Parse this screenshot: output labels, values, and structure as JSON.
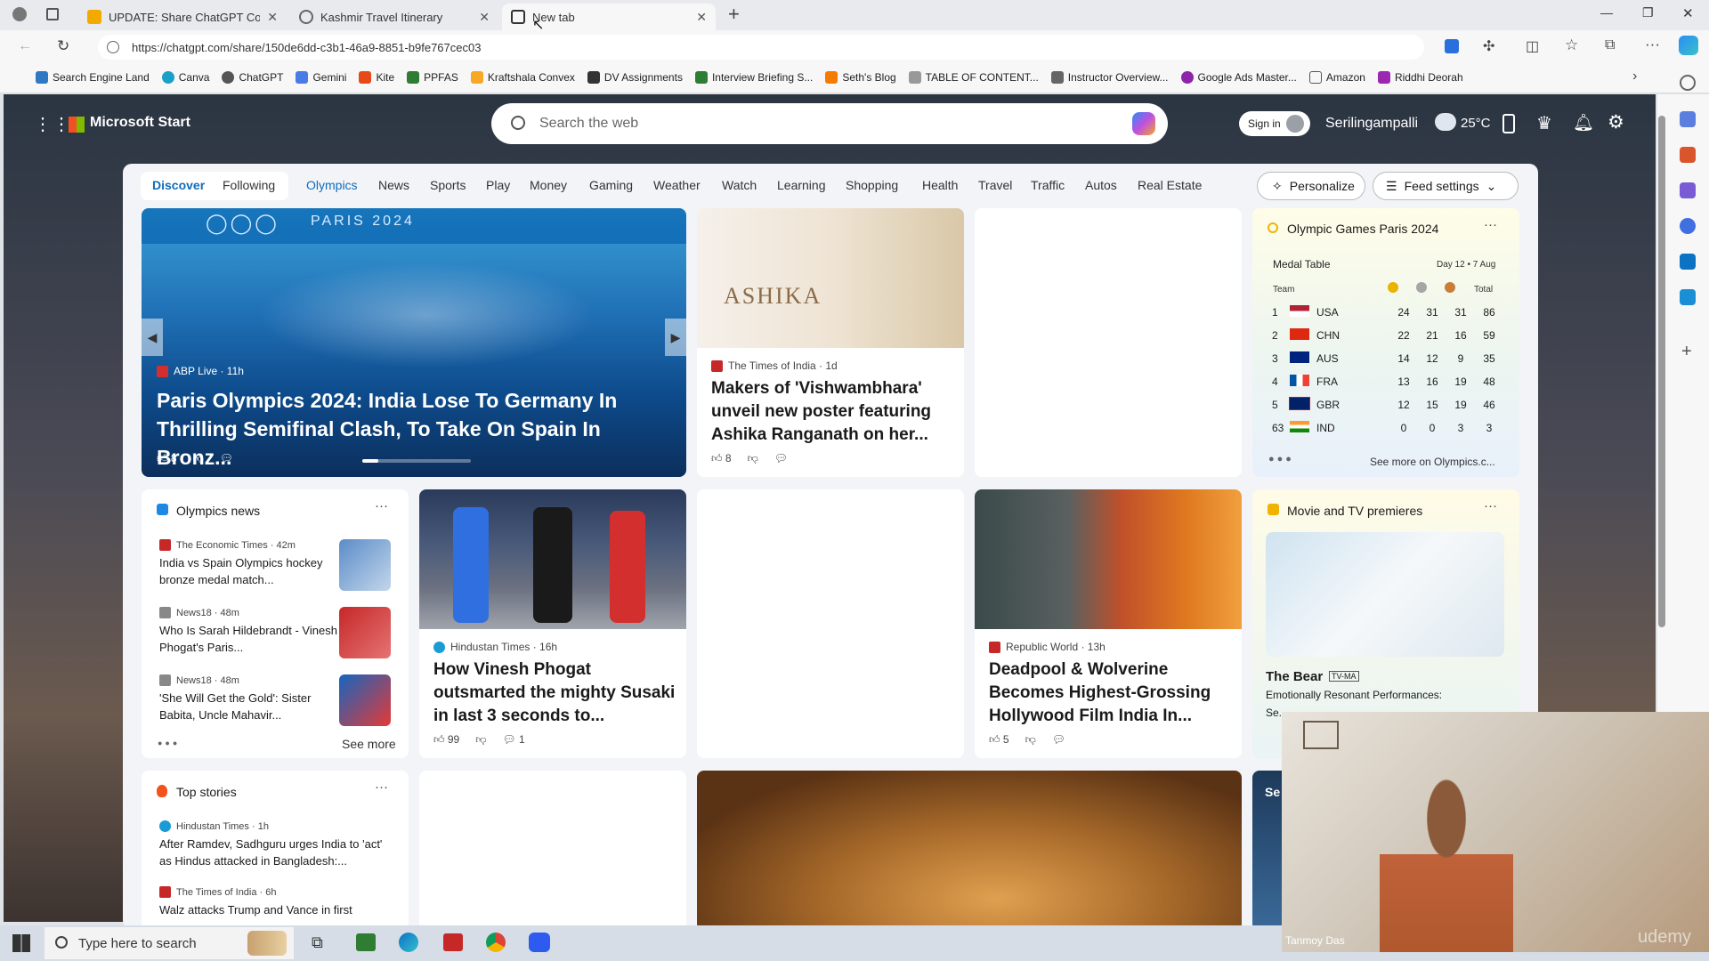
{
  "browser": {
    "tabs": [
      {
        "label": "UPDATE: Share ChatGPT Convers...",
        "color": "#f2a900"
      },
      {
        "label": "Kashmir Travel Itinerary",
        "color": "#666"
      },
      {
        "label": "New tab",
        "color": "#333"
      }
    ],
    "url": "https://chatgpt.com/share/150de6dd-c3b1-46a9-8851-b9fe767cec03",
    "bookmarks": [
      "Search Engine Land",
      "Canva",
      "ChatGPT",
      "Gemini",
      "Kite",
      "PPFAS",
      "Kraftshala Convex",
      "DV Assignments",
      "Interview Briefing S...",
      "Seth's Blog",
      "TABLE OF CONTENT...",
      "Instructor Overview...",
      "Google Ads Master...",
      "Amazon",
      "Riddhi Deorah"
    ]
  },
  "header": {
    "brand": "Microsoft Start",
    "search_placeholder": "Search the web",
    "sign_in": "Sign in",
    "location": "Serilingampalli",
    "temperature": "25°C"
  },
  "nav": {
    "items": [
      "Discover",
      "Following",
      "Olympics",
      "News",
      "Sports",
      "Play",
      "Money",
      "Gaming",
      "Weather",
      "Watch",
      "Learning",
      "Shopping",
      "Health",
      "Travel",
      "Traffic",
      "Autos",
      "Real Estate"
    ],
    "personalize": "Personalize",
    "feed_settings": "Feed settings"
  },
  "hero": {
    "source": "ABP Live · 11h",
    "title": "Paris Olympics 2024: India Lose To Germany In Thrilling Semifinal Clash, To Take On Spain In Bronz...",
    "likes": "8",
    "banner": "PARIS 2024"
  },
  "card_ashika": {
    "source": "The Times of India · 1d",
    "title": "Makers of 'Vishwambhara' unveil new poster featuring Ashika Ranganath on her...",
    "likes": "8",
    "img_text": "ASHIKA"
  },
  "medals": {
    "title": "Olympic Games Paris 2024",
    "subtitle": "Medal Table",
    "dates": "Day 12 • 7 Aug",
    "team_header": "Team",
    "total_header": "Total",
    "rows": [
      {
        "rank": "1",
        "team": "USA",
        "g": "24",
        "s": "31",
        "b": "31",
        "t": "86"
      },
      {
        "rank": "2",
        "team": "CHN",
        "g": "22",
        "s": "21",
        "b": "16",
        "t": "59"
      },
      {
        "rank": "3",
        "team": "AUS",
        "g": "14",
        "s": "12",
        "b": "9",
        "t": "35"
      },
      {
        "rank": "4",
        "team": "FRA",
        "g": "13",
        "s": "16",
        "b": "19",
        "t": "48"
      },
      {
        "rank": "5",
        "team": "GBR",
        "g": "12",
        "s": "15",
        "b": "19",
        "t": "46"
      },
      {
        "rank": "63",
        "team": "IND",
        "g": "0",
        "s": "0",
        "b": "3",
        "t": "3"
      }
    ],
    "see_more": "See more on Olympics.c..."
  },
  "olympics_news": {
    "title": "Olympics news",
    "items": [
      {
        "source": "The Economic Times · 42m",
        "text": "India vs Spain Olympics hockey bronze medal match..."
      },
      {
        "source": "News18 · 48m",
        "text": "Who Is Sarah Hildebrandt - Vinesh Phogat's Paris..."
      },
      {
        "source": "News18 · 48m",
        "text": "'She Will Get the Gold': Sister Babita, Uncle Mahavir..."
      }
    ],
    "see_more": "See more"
  },
  "card_vinesh": {
    "source": "Hindustan Times · 16h",
    "title": "How Vinesh Phogat outsmarted the mighty Susaki in last 3 seconds to...",
    "likes": "99",
    "comments": "1"
  },
  "card_deadpool": {
    "source": "Republic World · 13h",
    "title": "Deadpool & Wolverine Becomes Highest-Grossing Hollywood Film India In...",
    "likes": "5"
  },
  "movies": {
    "title": "Movie and TV premieres",
    "show": "The Bear",
    "rating": "TV-MA",
    "desc": "Emotionally Resonant Performances:",
    "desc2": "Se..."
  },
  "top_stories": {
    "title": "Top stories",
    "items": [
      {
        "source": "Hindustan Times · 1h",
        "text": "After Ramdev, Sadhguru urges India to 'act' as Hindus attacked in Bangladesh:..."
      },
      {
        "source": "The Times of India · 6h",
        "text": "Walz attacks Trump and Vance in first"
      }
    ]
  },
  "partial_card_label": "Se",
  "taskbar": {
    "search": "Type here to search"
  },
  "webcam": {
    "name": "Tanmoy Das",
    "watermark": "udemy"
  }
}
